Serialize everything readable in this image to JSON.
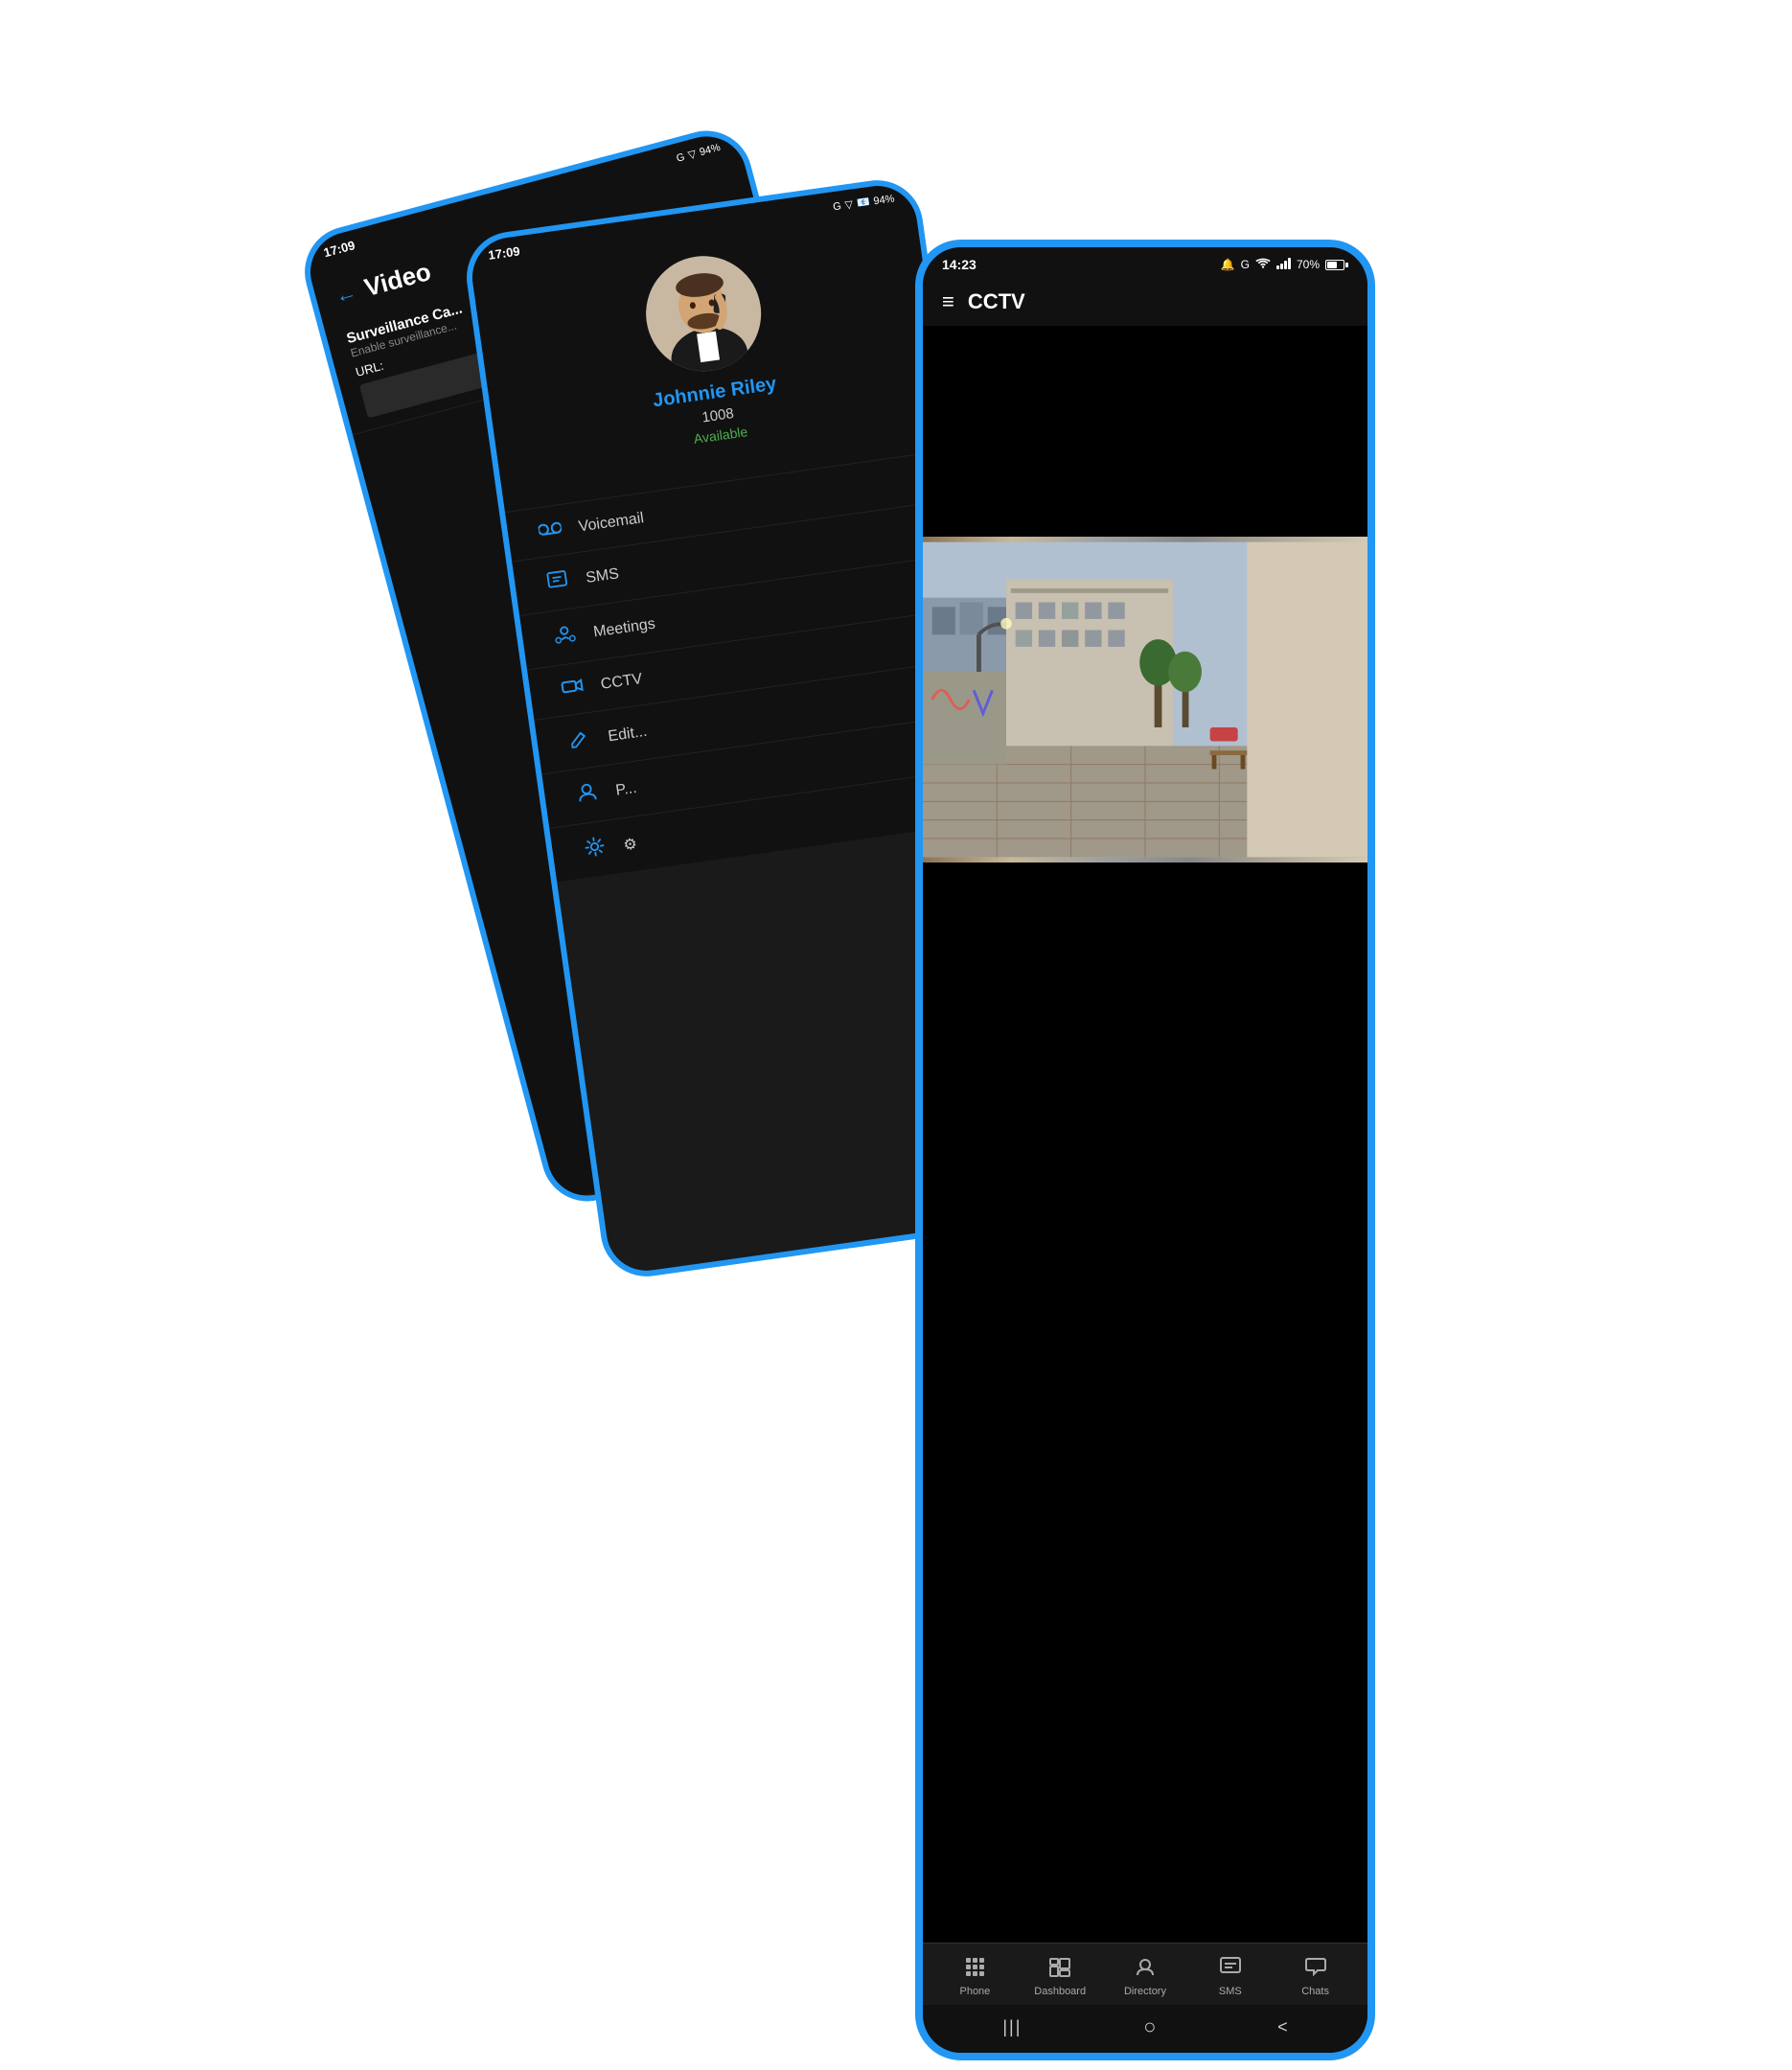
{
  "phones": {
    "back": {
      "statusBar": {
        "time": "17:09",
        "icons": [
          "G",
          "V"
        ]
      },
      "title": "Video",
      "backLabel": "←",
      "sectionTitle": "Surveillance Ca...",
      "sectionSub": "Enable surveillance...",
      "urlLabel": "URL:"
    },
    "mid": {
      "statusBar": {
        "time": "17:09",
        "icons": [
          "G",
          "V",
          "📧"
        ]
      },
      "user": {
        "name": "Johnnie Riley",
        "ext": "1008",
        "status": "Available"
      },
      "menuItems": [
        {
          "icon": "voicemail",
          "label": "Voicemail"
        },
        {
          "icon": "sms",
          "label": "SMS"
        },
        {
          "icon": "meetings",
          "label": "Meetings"
        },
        {
          "icon": "cctv",
          "label": "CCTV"
        },
        {
          "icon": "edit",
          "label": "Edit..."
        },
        {
          "icon": "profile",
          "label": "P..."
        },
        {
          "icon": "settings",
          "label": "⚙"
        }
      ]
    },
    "front": {
      "statusBar": {
        "time": "14:23",
        "battery": "70%",
        "icons": [
          "wifi",
          "signal",
          "battery"
        ]
      },
      "header": {
        "menuIcon": "≡",
        "title": "CCTV"
      },
      "bottomNav": [
        {
          "icon": "phone",
          "label": "Phone"
        },
        {
          "icon": "dashboard",
          "label": "Dashboard"
        },
        {
          "icon": "directory",
          "label": "Directory"
        },
        {
          "icon": "sms",
          "label": "SMS"
        },
        {
          "icon": "chats",
          "label": "Chats"
        }
      ],
      "homeBar": [
        "|||",
        "○",
        "<"
      ]
    }
  }
}
